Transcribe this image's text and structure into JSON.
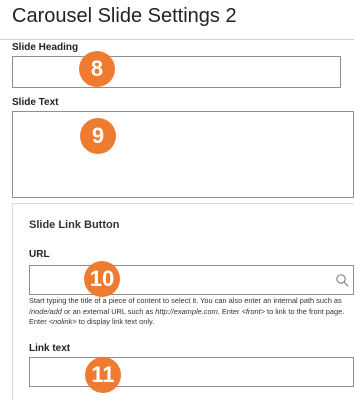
{
  "page": {
    "title": "Carousel Slide Settings 2"
  },
  "fields": {
    "slide_heading": {
      "label": "Slide Heading",
      "value": "",
      "badge": "8"
    },
    "slide_text": {
      "label": "Slide Text",
      "value": "",
      "badge": "9"
    }
  },
  "link_panel": {
    "title": "Slide Link Button",
    "url": {
      "label": "URL",
      "value": "",
      "badge": "10",
      "icon": "search-icon"
    },
    "help": {
      "t1": "Start typing the title of a piece of content to select it. You can also enter an internal path such as ",
      "ex_node": "/node/add",
      "t2": " or an external URL such as ",
      "ex_url": "http://example.com",
      "t3": ". Enter ",
      "ex_front": "<front>",
      "t4": " to link to the front page. Enter ",
      "ex_nolink": "<nolink>",
      "t5": " to display link text only."
    },
    "link_text": {
      "label": "Link text",
      "value": "",
      "badge": "11"
    }
  },
  "colors": {
    "badge": "#ee7b30",
    "border": "#8f8f8f"
  }
}
